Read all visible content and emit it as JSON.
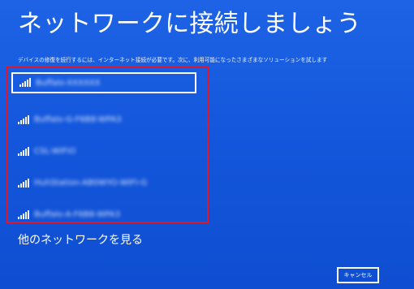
{
  "page": {
    "title": "ネットワークに接続しましょう",
    "subtitle": "デバイスの修復を続行するには、インターネット接続が必要です。次に、利用可能になったさまざまなソリューションを試します"
  },
  "networks": [
    {
      "name": "Buffalo-XXXXXX",
      "selected": true,
      "icon": "wifi-signal-icon"
    },
    {
      "name": "Buffalo-G-F6B8-WPA3",
      "selected": false,
      "icon": "wifi-signal-icon"
    },
    {
      "name": "CSL-WIFIO",
      "selected": false,
      "icon": "wifi-signal-icon"
    },
    {
      "name": "HuhStation-AB0WYO-WIFI-G",
      "selected": false,
      "icon": "wifi-signal-icon"
    },
    {
      "name": "Buffalo-A-F6B8-WPA3",
      "selected": false,
      "icon": "wifi-signal-icon"
    }
  ],
  "actions": {
    "other_networks": "他のネットワークを見る",
    "cancel": "キャンセル"
  },
  "colors": {
    "background": "#1457dc",
    "highlight_border": "#e0162b",
    "text": "#ffffff"
  }
}
